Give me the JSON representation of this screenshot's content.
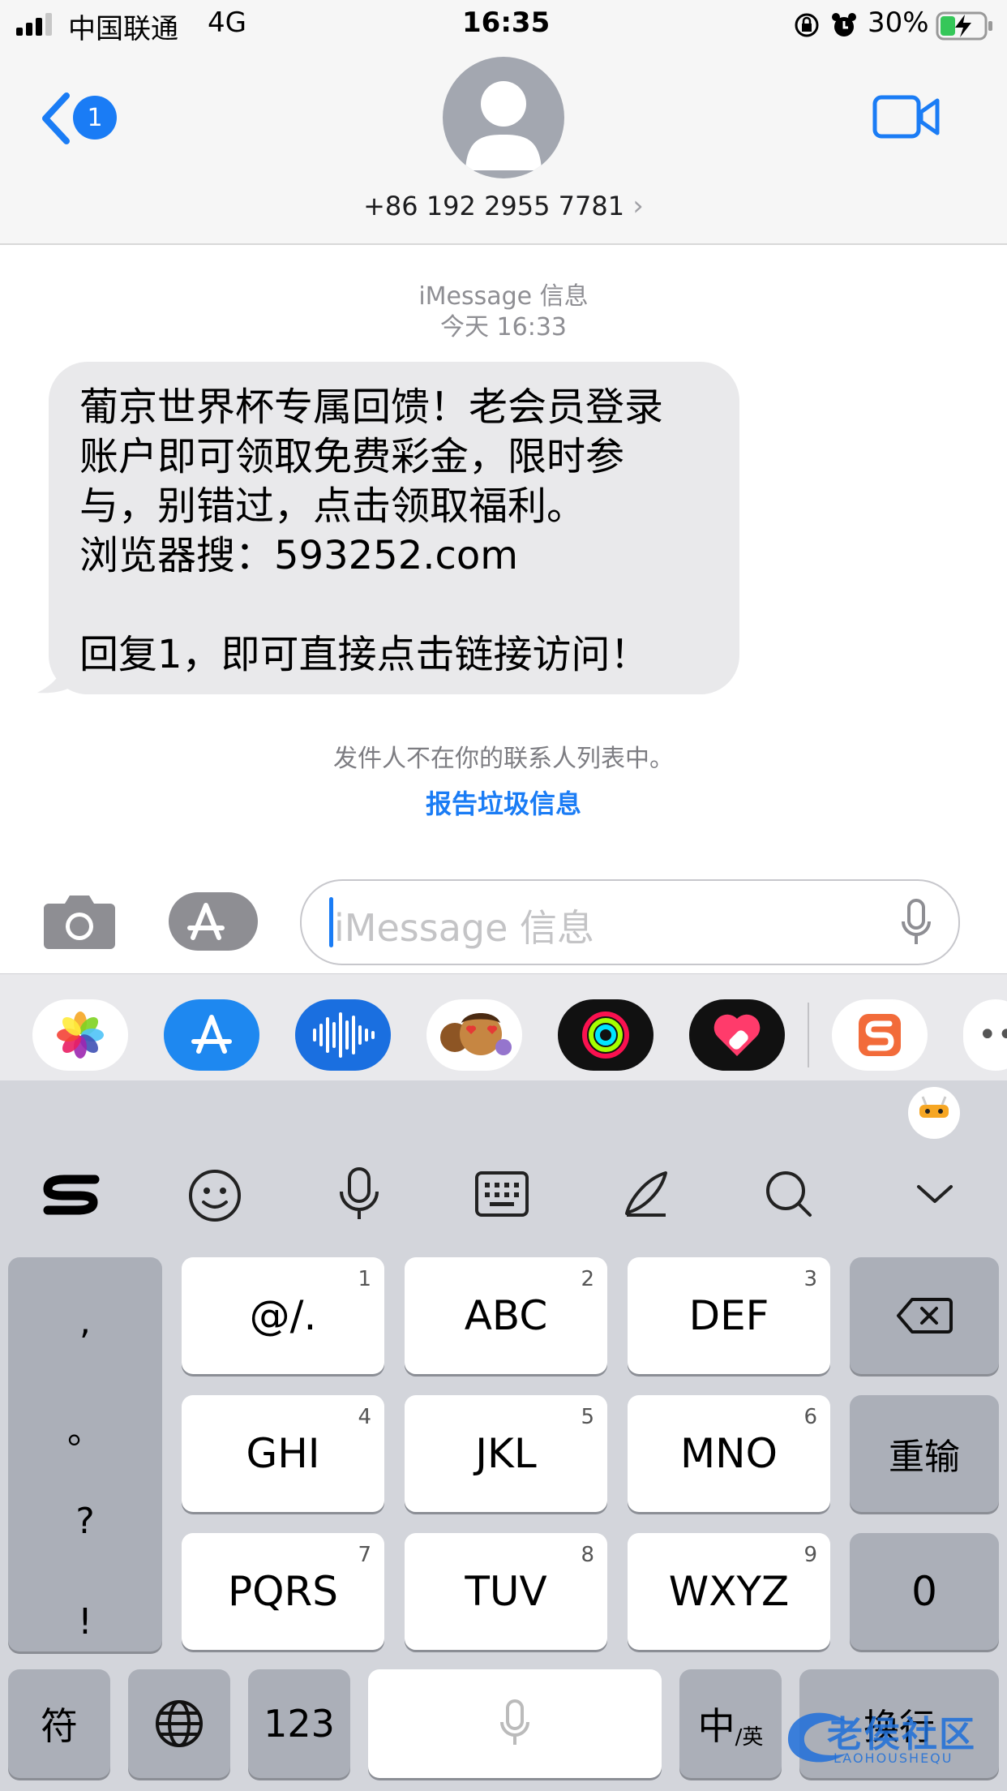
{
  "status_bar": {
    "carrier": "中国联通",
    "network": "4G",
    "time": "16:35",
    "battery": "30%"
  },
  "header": {
    "back_badge": "1",
    "contact": "+86 192 2955 7781",
    "chevron": "›"
  },
  "chat": {
    "service_label": "iMessage 信息",
    "timestamp": "今天 16:33",
    "message_lines": [
      "葡京世界杯专属回馈！老会员登录",
      "账户即可领取免费彩金，限时参",
      "与，别错过，点击领取福利。",
      "浏览器搜：593252.com",
      "",
      "回复1，即可直接点击链接访问！"
    ],
    "sender_notice": "发件人不在你的联系人列表中。",
    "report_link": "报告垃圾信息"
  },
  "compose": {
    "placeholder": "iMessage 信息"
  },
  "keyboard": {
    "punctuation": [
      ",",
      "。",
      "?",
      "!"
    ],
    "keys": [
      {
        "label": "@/.",
        "num": "1"
      },
      {
        "label": "ABC",
        "num": "2"
      },
      {
        "label": "DEF",
        "num": "3"
      },
      {
        "label": "GHI",
        "num": "4"
      },
      {
        "label": "JKL",
        "num": "5"
      },
      {
        "label": "MNO",
        "num": "6"
      },
      {
        "label": "PQRS",
        "num": "7"
      },
      {
        "label": "TUV",
        "num": "8"
      },
      {
        "label": "WXYZ",
        "num": "9"
      }
    ],
    "retype": "重输",
    "zero": "0",
    "symbols": "符",
    "num_mode": "123",
    "lang_main": "中",
    "lang_sub": "/英",
    "return": "换行"
  },
  "watermark": {
    "text": "老侯社区",
    "sub": "LAOHOUSHEQU"
  },
  "colors": {
    "accent": "#1a7cf5",
    "bubble": "#e9e9eb",
    "battery_fill": "#35c759"
  }
}
